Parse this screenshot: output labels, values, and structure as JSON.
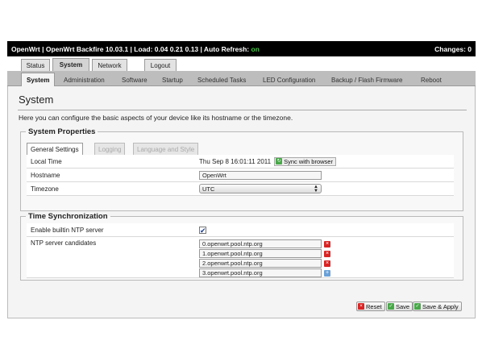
{
  "topbar": {
    "prefix": "OpenWrt | OpenWrt Backfire 10.03.1 | Load: 0.04 0.21 0.13 | Auto Refresh: ",
    "refresh": "on",
    "changes": "Changes: 0"
  },
  "main_tabs": [
    "Status",
    "System",
    "Network",
    "Logout"
  ],
  "sub_tabs": [
    "System",
    "Administration",
    "Software",
    "Startup",
    "Scheduled Tasks",
    "LED Configuration",
    "Backup / Flash Firmware",
    "Reboot"
  ],
  "page": {
    "title": "System",
    "description": "Here you can configure the basic aspects of your device like its hostname or the timezone."
  },
  "system_properties": {
    "legend": "System Properties",
    "tabs": [
      "General Settings",
      "Logging",
      "Language and Style"
    ],
    "local_time_label": "Local Time",
    "local_time_value": "Thu Sep 8 16:01:11 2011",
    "sync_button": "Sync with browser",
    "hostname_label": "Hostname",
    "hostname_value": "OpenWrt",
    "timezone_label": "Timezone",
    "timezone_value": "UTC"
  },
  "time_sync": {
    "legend": "Time Synchronization",
    "ntp_enable_label": "Enable builtin NTP server",
    "ntp_enabled": true,
    "candidates_label": "NTP server candidates",
    "servers": [
      "0.openwrt.pool.ntp.org",
      "1.openwrt.pool.ntp.org",
      "2.openwrt.pool.ntp.org",
      "3.openwrt.pool.ntp.org"
    ]
  },
  "actions": {
    "reset": "Reset",
    "save": "Save",
    "save_apply": "Save & Apply"
  }
}
